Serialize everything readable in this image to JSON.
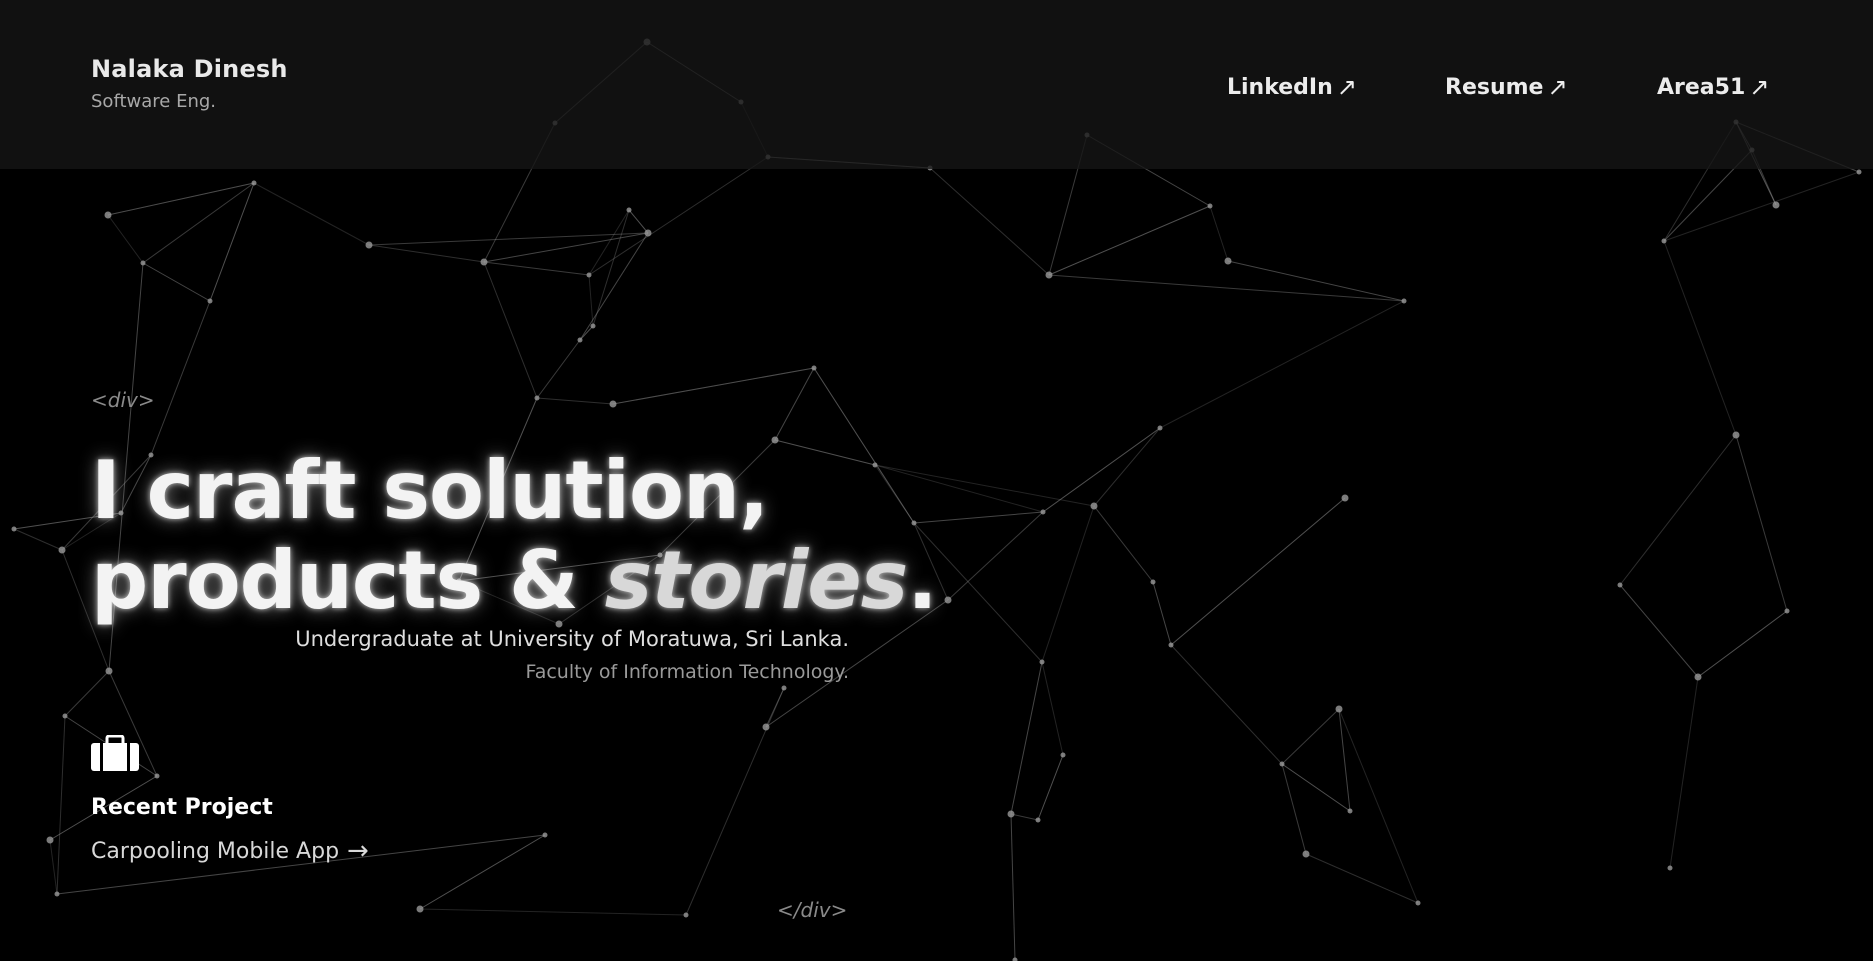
{
  "brand": {
    "name": "Nalaka Dinesh",
    "role": "Software Eng."
  },
  "nav": [
    {
      "label": "LinkedIn",
      "icon": "external-arrow-icon"
    },
    {
      "label": "Resume",
      "icon": "external-arrow-icon"
    },
    {
      "label": "Area51",
      "icon": "external-arrow-icon"
    }
  ],
  "hero": {
    "open_tag": "<div>",
    "line1": "I craft solution,",
    "line2_prefix": "products & ",
    "line2_emphasis": "stories",
    "line2_suffix": ".",
    "close_tag": "</div>",
    "subtitle": "Undergraduate at University of Moratuwa, Sri Lanka.",
    "faculty": "Faculty of Information Technology."
  },
  "recent_project": {
    "icon": "briefcase-icon",
    "title": "Recent Project",
    "link_label": "Carpooling Mobile App",
    "link_icon": "arrow-right-icon"
  },
  "colors": {
    "background": "#000000",
    "topbar": "#161616",
    "text": "#f3f3f3",
    "muted": "#9a9a9a",
    "network": "#8c8c8c"
  }
}
